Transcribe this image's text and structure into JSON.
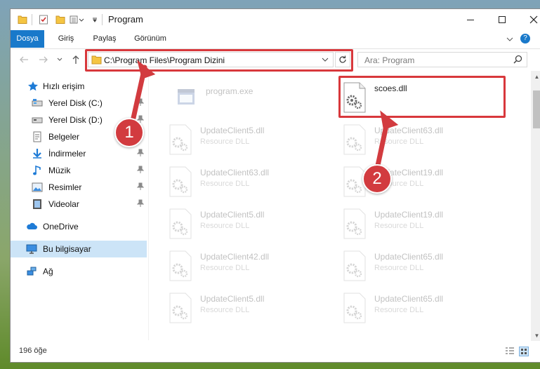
{
  "window": {
    "title": "Program",
    "controls": {
      "minimize": "minimize-icon",
      "maximize": "maximize-icon",
      "close": "close-icon"
    }
  },
  "ribbon": {
    "tabs": [
      {
        "label": "Dosya",
        "active": true
      },
      {
        "label": "Giriş",
        "active": false
      },
      {
        "label": "Paylaş",
        "active": false
      },
      {
        "label": "Görünüm",
        "active": false
      }
    ],
    "help": "?"
  },
  "address_bar": {
    "path": "C:\\Program Files\\Program Dizini"
  },
  "search": {
    "placeholder": "Ara: Program"
  },
  "sidebar": {
    "items": [
      {
        "label": "Hızlı erişim",
        "icon": "star-icon",
        "pinned": false
      },
      {
        "label": "Yerel Disk (C:)",
        "icon": "drive-icon",
        "pinned": true
      },
      {
        "label": "Yerel Disk (D:)",
        "icon": "drive-icon",
        "pinned": true
      },
      {
        "label": "Belgeler",
        "icon": "documents-icon",
        "pinned": false
      },
      {
        "label": "İndirmeler",
        "icon": "download-icon",
        "pinned": true
      },
      {
        "label": "Müzik",
        "icon": "music-icon",
        "pinned": true
      },
      {
        "label": "Resimler",
        "icon": "pictures-icon",
        "pinned": true
      },
      {
        "label": "Videolar",
        "icon": "videos-icon",
        "pinned": true
      },
      {
        "label": "OneDrive",
        "icon": "cloud-icon",
        "pinned": false
      },
      {
        "label": "Bu bilgisayar",
        "icon": "computer-icon",
        "pinned": false,
        "selected": true
      },
      {
        "label": "Ağ",
        "icon": "network-icon",
        "pinned": false
      }
    ]
  },
  "files": [
    {
      "name": "program.exe",
      "type": "",
      "icon": "exe-icon",
      "faded": true
    },
    {
      "name": "scoes.dll",
      "type": "",
      "icon": "dll-gear-icon",
      "faded": false,
      "highlighted": true
    },
    {
      "name": "UpdateClient5.dll",
      "type": "Resource DLL",
      "icon": "dll-gear-icon",
      "faded": true
    },
    {
      "name": "UpdateClient63.dll",
      "type": "Resource DLL",
      "icon": "dll-gear-icon",
      "faded": true
    },
    {
      "name": "UpdateClient63.dll",
      "type": "Resource DLL",
      "icon": "dll-gear-icon",
      "faded": true
    },
    {
      "name": "UpdateClient19.dll",
      "type": "Resource DLL",
      "icon": "dll-gear-icon",
      "faded": true
    },
    {
      "name": "UpdateClient5.dll",
      "type": "Resource DLL",
      "icon": "dll-gear-icon",
      "faded": true
    },
    {
      "name": "UpdateClient19.dll",
      "type": "Resource DLL",
      "icon": "dll-gear-icon",
      "faded": true
    },
    {
      "name": "UpdateClient42.dll",
      "type": "Resource DLL",
      "icon": "dll-gear-icon",
      "faded": true
    },
    {
      "name": "UpdateClient65.dll",
      "type": "Resource DLL",
      "icon": "dll-gear-icon",
      "faded": true
    },
    {
      "name": "UpdateClient5.dll",
      "type": "Resource DLL",
      "icon": "dll-gear-icon",
      "faded": true
    },
    {
      "name": "UpdateClient65.dll",
      "type": "Resource DLL",
      "icon": "dll-gear-icon",
      "faded": true
    }
  ],
  "status": {
    "item_count": "196 öğe"
  },
  "callouts": [
    "1",
    "2"
  ],
  "colors": {
    "accent": "#1979ca",
    "highlight": "#d8383c",
    "selected_bg": "#cce4f7"
  }
}
